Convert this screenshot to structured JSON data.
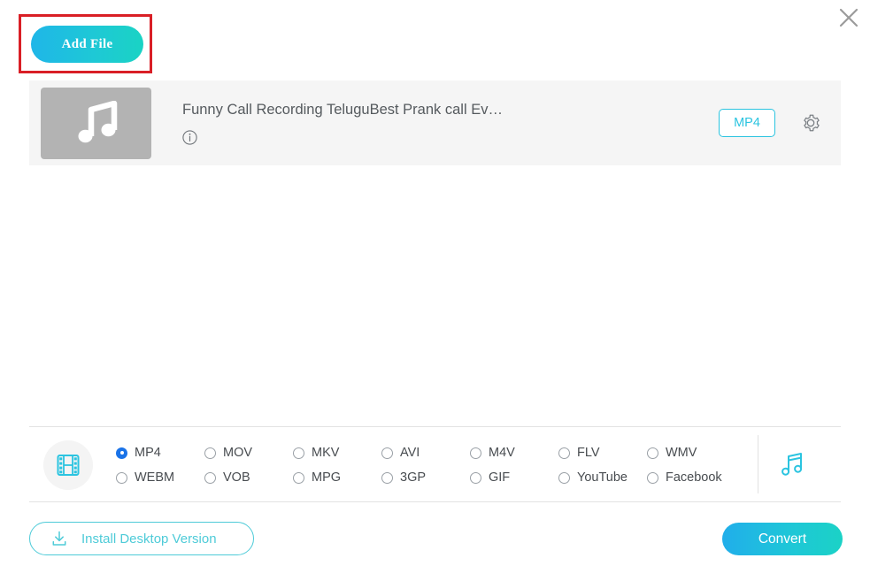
{
  "window": {
    "close_icon": "close-icon"
  },
  "toolbar": {
    "add_file_label": "Add File",
    "annotation_color": "#d91f26",
    "accent_color": "#1ec8d6"
  },
  "file_list": {
    "items": [
      {
        "thumb_icon": "music-note-icon",
        "title": "Funny Call Recording TeluguBest Prank call Ev…",
        "info_icon": "info-icon",
        "format_badge": "MP4",
        "settings_icon": "gear-icon"
      }
    ]
  },
  "formats": {
    "video_icon": "film-strip-icon",
    "audio_icon": "music-note-icon",
    "selected": "MP4",
    "options": [
      {
        "label": "MP4",
        "selected": true
      },
      {
        "label": "MOV",
        "selected": false
      },
      {
        "label": "MKV",
        "selected": false
      },
      {
        "label": "AVI",
        "selected": false
      },
      {
        "label": "M4V",
        "selected": false
      },
      {
        "label": "FLV",
        "selected": false
      },
      {
        "label": "WMV",
        "selected": false
      },
      {
        "label": "WEBM",
        "selected": false
      },
      {
        "label": "VOB",
        "selected": false
      },
      {
        "label": "MPG",
        "selected": false
      },
      {
        "label": "3GP",
        "selected": false
      },
      {
        "label": "GIF",
        "selected": false
      },
      {
        "label": "YouTube",
        "selected": false
      },
      {
        "label": "Facebook",
        "selected": false
      }
    ]
  },
  "footer": {
    "install_label": "Install Desktop Version",
    "install_icon": "download-icon",
    "convert_label": "Convert"
  }
}
